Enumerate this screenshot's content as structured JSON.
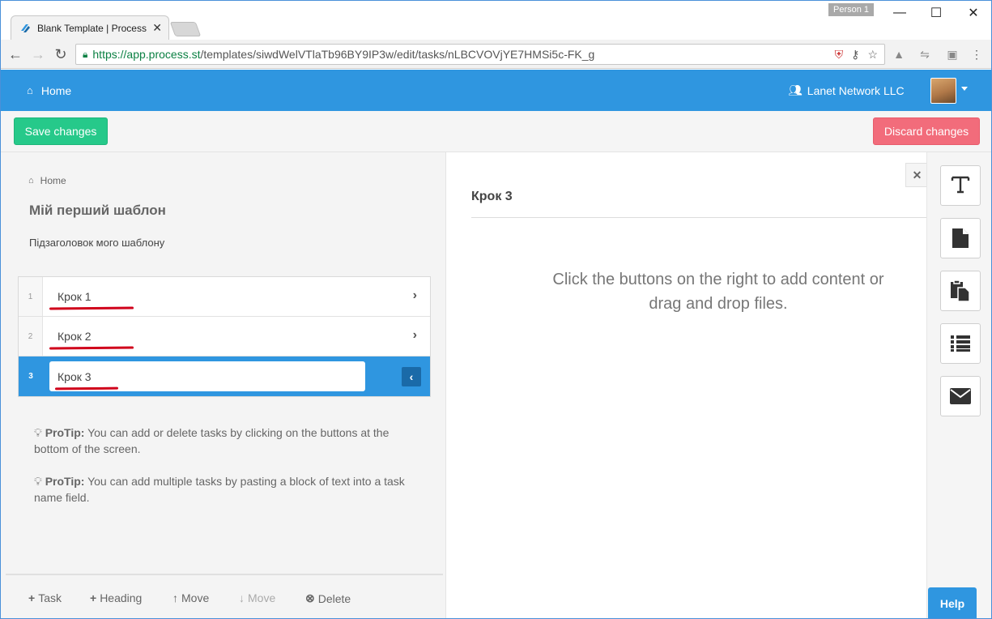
{
  "browser": {
    "tab_title": "Blank Template | Process",
    "profile": "Person 1",
    "url_secure": "https://",
    "url_host": "app.process.st",
    "url_path": "/templates/siwdWelVTlaTb96BY9IP3w/edit/tasks/nLBCVOVjYE7HMSi5c-FK_g"
  },
  "header": {
    "home_label": "Home",
    "org_name": "Lanet Network LLC"
  },
  "toolbar": {
    "save_label": "Save changes",
    "discard_label": "Discard changes"
  },
  "left": {
    "breadcrumb": "Home",
    "template_title": "Мій перший шаблон",
    "template_subtitle": "Підзаголовок мого шаблону",
    "tasks": [
      {
        "number": "1",
        "name": "Крок 1"
      },
      {
        "number": "2",
        "name": "Крок 2"
      },
      {
        "number": "3",
        "name": "Крок 3"
      }
    ],
    "protips": [
      {
        "label": "ProTip:",
        "text": " You can add or delete tasks by clicking on the buttons at the bottom of the screen."
      },
      {
        "label": "ProTip:",
        "text": " You can add multiple tasks by pasting a block of text into a task name field."
      }
    ],
    "bottom_actions": {
      "task": "Task",
      "heading": "Heading",
      "move_up": "Move",
      "move_down": "Move",
      "delete": "Delete"
    }
  },
  "right": {
    "step_title": "Крок 3",
    "empty_message": "Click the buttons on the right to add content or drag and drop files.",
    "help_label": "Help"
  },
  "colors": {
    "brand_blue": "#2f96e0",
    "save_green": "#26c98a",
    "discard_red": "#f26c7b",
    "annotation_red": "#d0021b"
  },
  "icons": {
    "side_toolbar": [
      "text-icon",
      "file-icon",
      "copy-file-icon",
      "list-icon",
      "envelope-icon"
    ]
  }
}
